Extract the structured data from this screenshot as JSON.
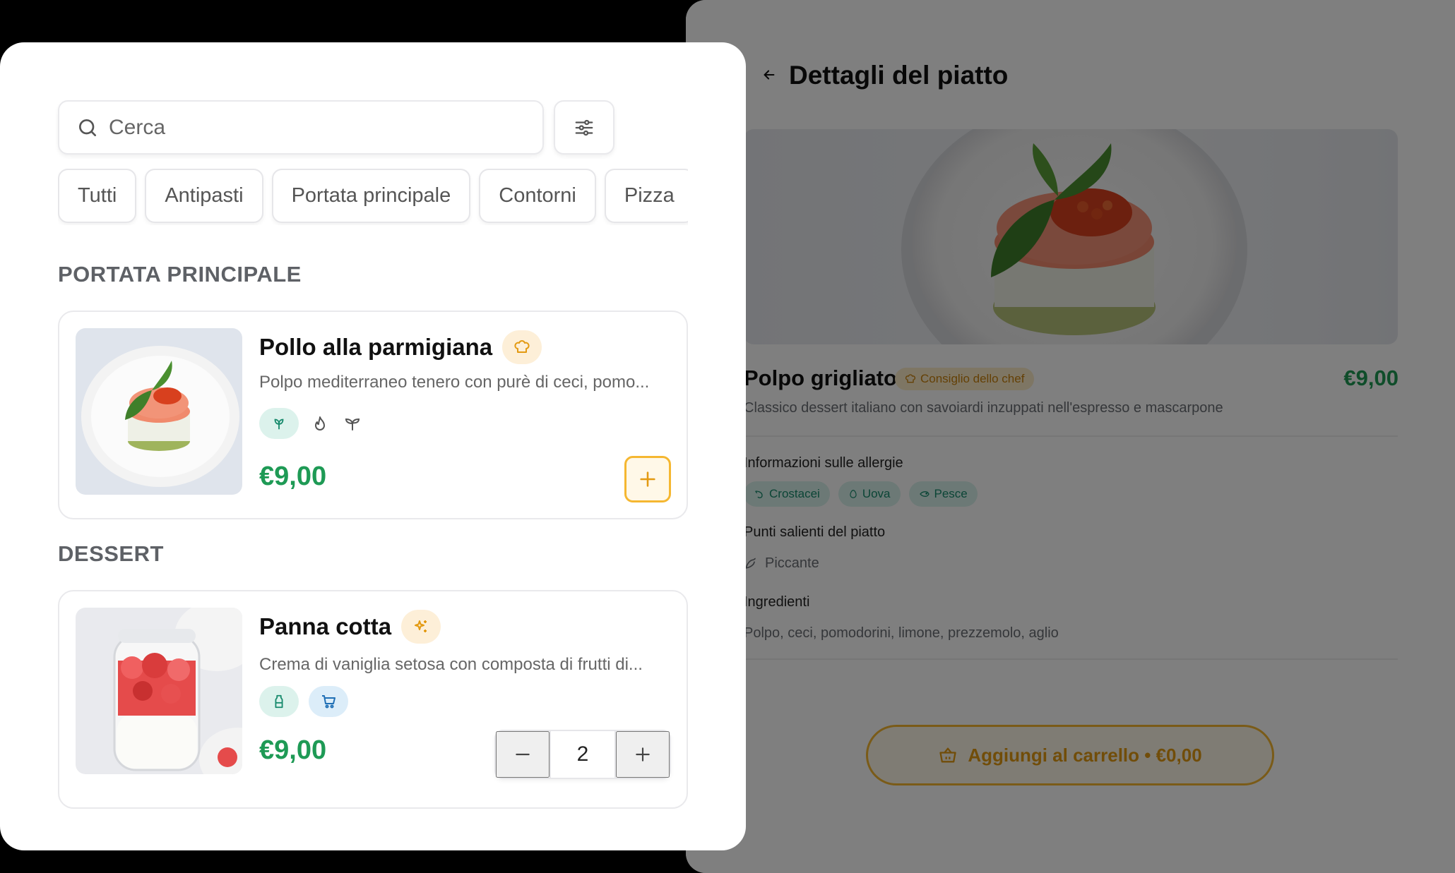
{
  "detail": {
    "title": "Dettagli del piatto",
    "dish_name": "Polpo grigliato",
    "chef_badge": "Consiglio dello chef",
    "price": "€9,00",
    "description": "Classico dessert italiano con savoiardi inzuppati nell'espresso e mascarpone",
    "allergies_title": "Informazioni sulle allergie",
    "allergens": [
      {
        "label": "Crostacei",
        "icon": "shrimp-icon"
      },
      {
        "label": "Uova",
        "icon": "egg-icon"
      },
      {
        "label": "Pesce",
        "icon": "fish-icon"
      }
    ],
    "highlights_title": "Punti salienti del piatto",
    "highlight": "Piccante",
    "ingredients_title": "Ingredienti",
    "ingredients": "Polpo, ceci, pomodorini, limone, prezzemolo, aglio",
    "add_to_cart": "Aggiungi al carrello • €0,00"
  },
  "menu": {
    "search_placeholder": "Cerca",
    "categories": [
      "Tutti",
      "Antipasti",
      "Portata principale",
      "Contorni",
      "Pizza"
    ],
    "sections": [
      {
        "title": "PORTATA PRINCIPALE",
        "item": {
          "name": "Pollo alla parmigiana",
          "badge_icon": "chef-hat-icon",
          "description": "Polpo mediterraneo tenero con purè di ceci, pomo...",
          "icons": [
            "vegan-icon",
            "flame-icon",
            "sprout-icon"
          ],
          "price": "€9,00"
        }
      },
      {
        "title": "DESSERT",
        "item": {
          "name": "Panna cotta",
          "badge_icon": "sparkles-icon",
          "description": "Crema di vaniglia setosa con composta di frutti di...",
          "icons": [
            "milk-bottle-icon",
            "cart-icon"
          ],
          "price": "€9,00",
          "quantity": "2"
        }
      }
    ]
  },
  "colors": {
    "accent": "#f5b731",
    "price_green": "#1e9a55",
    "allergen_bg": "#d9f3ec",
    "allergen_text": "#178a6c"
  }
}
